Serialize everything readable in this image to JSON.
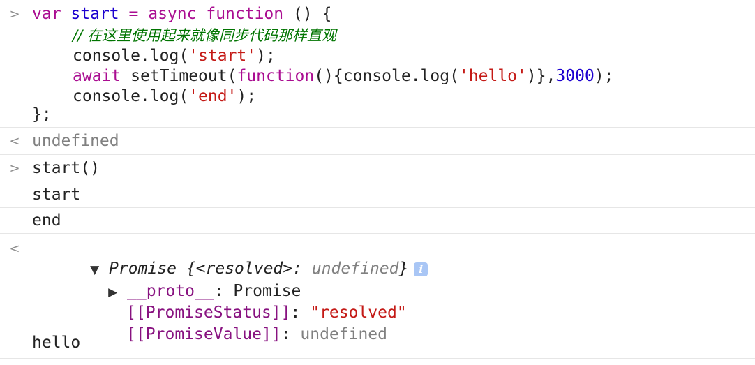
{
  "prompts": {
    "input": ">",
    "output": "<"
  },
  "entry1": {
    "code": {
      "l1": {
        "kw1": "var",
        "name": "start",
        "eq": "=",
        "kw2": "async",
        "kw3": "function",
        "rest": "() {"
      },
      "l2": {
        "comment": "// 在这里使用起来就像同步代码那样直观"
      },
      "l3": {
        "pre": "console.log(",
        "str": "'start'",
        "post": ");"
      },
      "l4": {
        "kw": "await",
        "mid1": "setTimeout(",
        "kw2": "function",
        "mid2": "(){console.log(",
        "str": "'hello'",
        "mid3": ")},",
        "num": "3000",
        "post": ");"
      },
      "l5": {
        "pre": "console.log(",
        "str": "'end'",
        "post": ");"
      },
      "l6": {
        "text": "};"
      }
    }
  },
  "result1": {
    "text": "undefined"
  },
  "entry2": {
    "code": "start()"
  },
  "logs": {
    "start": "start",
    "end": "end",
    "hello": "hello"
  },
  "promise": {
    "label": "Promise {",
    "key": "<resolved>",
    "colon": ":",
    "value": "undefined",
    "close": "}",
    "info_icon": "i",
    "proto": {
      "key": "__proto__",
      "colon": ":",
      "value": "Promise"
    },
    "status": {
      "key": "[[PromiseStatus]]",
      "colon": ":",
      "value": "\"resolved\""
    },
    "value_row": {
      "key": "[[PromiseValue]]",
      "colon": ":",
      "value": "undefined"
    },
    "expanded_arrow": "▼",
    "collapsed_arrow": "▶"
  }
}
